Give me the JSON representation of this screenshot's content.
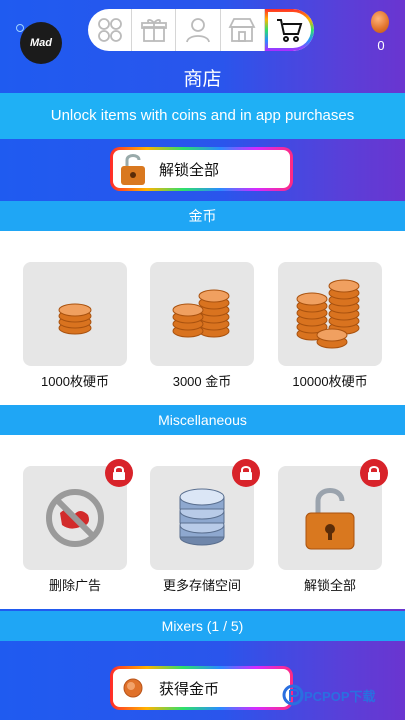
{
  "brand": {
    "logo_text": "Mad"
  },
  "nav": {
    "items": [
      "apps",
      "gift",
      "profile",
      "store",
      "cart"
    ],
    "active": "cart"
  },
  "coins": {
    "count": "0"
  },
  "page": {
    "title": "商店"
  },
  "info_banner": {
    "text": "Unlock items with coins and in app purchases"
  },
  "unlock_all_button": {
    "label": "解锁全部"
  },
  "sections": {
    "coins": "金币",
    "misc": "Miscellaneous",
    "mixers": "Mixers (1 / 5)"
  },
  "coin_packs": [
    {
      "label": "1000枚硬币"
    },
    {
      "label": "3000 金币"
    },
    {
      "label": "10000枚硬币"
    }
  ],
  "misc_items": [
    {
      "label": "删除广告"
    },
    {
      "label": "更多存储空间"
    },
    {
      "label": "解锁全部"
    }
  ],
  "get_coins_button": {
    "label": "获得金币"
  },
  "watermark": {
    "text": "PCPOP下载"
  },
  "colors": {
    "accent_blue": "#1f5bf0",
    "banner_blue": "#1fb0f5",
    "lock_red": "#d8232a",
    "coin_orange": "#e0712a"
  }
}
